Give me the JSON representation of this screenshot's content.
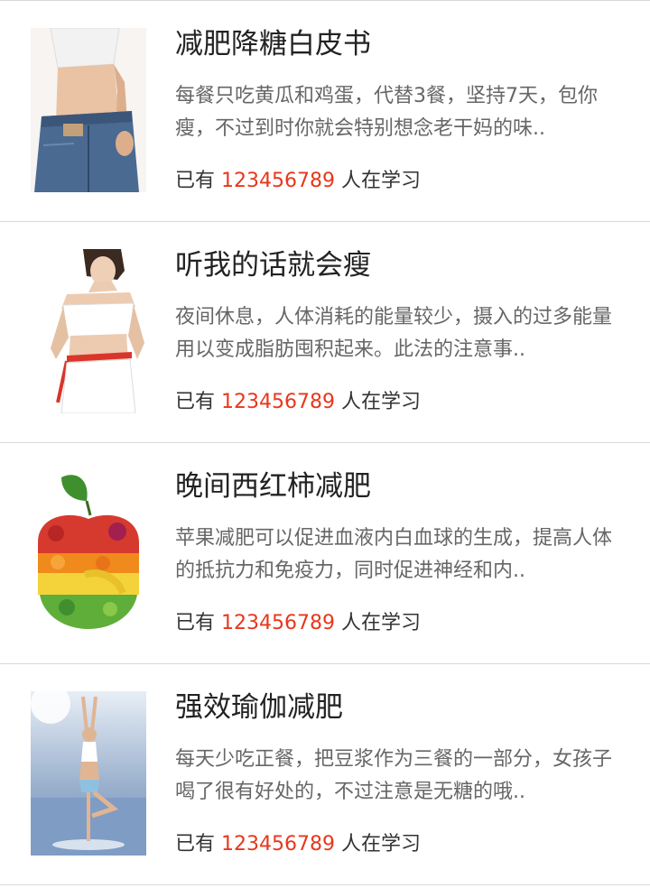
{
  "items": [
    {
      "title": "减肥降糖白皮书",
      "desc": "每餐只吃黄瓜和鸡蛋，代替3餐，坚持7天，包你瘦，不过到时你就会特别想念老干妈的味..",
      "prefix": "已有",
      "count": "123456789",
      "suffix": "人在学习",
      "image": "waist-jeans-photo"
    },
    {
      "title": "听我的话就会瘦",
      "desc": "夜间休息，人体消耗的能量较少，摄入的过多能量用以变成脂肪囤积起来。此法的注意事..",
      "prefix": "已有",
      "count": "123456789",
      "suffix": "人在学习",
      "image": "tape-measure-photo"
    },
    {
      "title": "晚间西红柿减肥",
      "desc": "苹果减肥可以促进血液内白血球的生成，提高人体的抵抗力和免疫力，同时促进神经和内..",
      "prefix": "已有",
      "count": "123456789",
      "suffix": "人在学习",
      "image": "fruit-apple-photo"
    },
    {
      "title": "强效瑜伽减肥",
      "desc": "每天少吃正餐，把豆浆作为三餐的一部分，女孩子喝了很有好处的，不过注意是无糖的哦..",
      "prefix": "已有",
      "count": "123456789",
      "suffix": "人在学习",
      "image": "yoga-pose-photo"
    }
  ]
}
